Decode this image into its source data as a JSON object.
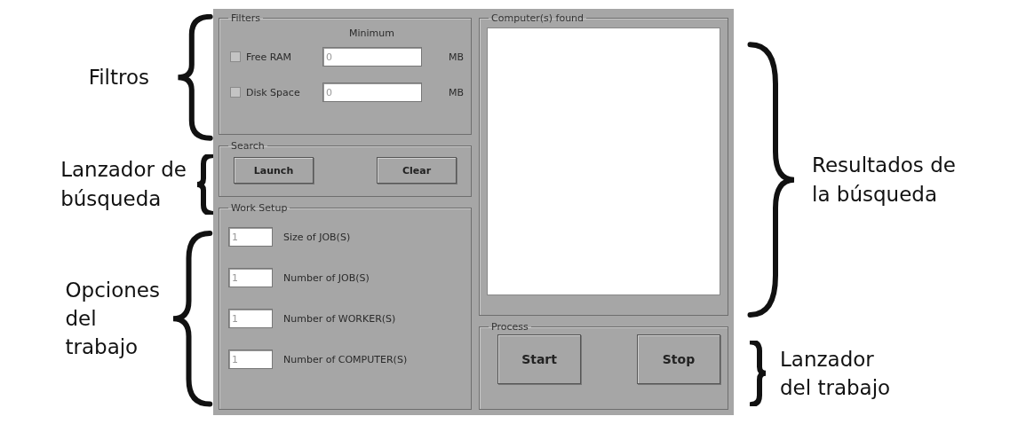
{
  "annotations_left": [
    {
      "text": "Filtros"
    },
    {
      "text": "Lanzador de\nbúsqueda"
    },
    {
      "text": "Opciones\ndel\ntrabajo"
    }
  ],
  "filters": {
    "title": "Filters",
    "column_header": "Minimum",
    "rows": [
      {
        "label": "Free RAM",
        "checked": false,
        "value": "0",
        "unit": "MB"
      },
      {
        "label": "Disk Space",
        "checked": false,
        "value": "0",
        "unit": "MB"
      }
    ]
  },
  "search": {
    "title": "Search",
    "buttons": [
      "Launch",
      "Clear"
    ]
  },
  "work_setup": {
    "title": "Work Setup",
    "fields": [
      {
        "value": "1",
        "label": "Size of JOB(S)"
      },
      {
        "value": "1",
        "label": "Number of JOB(S)"
      },
      {
        "value": "1",
        "label": "Number of WORKER(S)"
      },
      {
        "value": "1",
        "label": "Number of COMPUTER(S)"
      }
    ]
  },
  "results": {
    "title": "Computer(s) found"
  },
  "process": {
    "title": "Process",
    "buttons": [
      "Start",
      "Stop"
    ]
  },
  "annotations_right": [
    {
      "text": "Resultados de\nla búsqueda"
    },
    {
      "text": "Lanzador\ndel trabajo"
    }
  ]
}
